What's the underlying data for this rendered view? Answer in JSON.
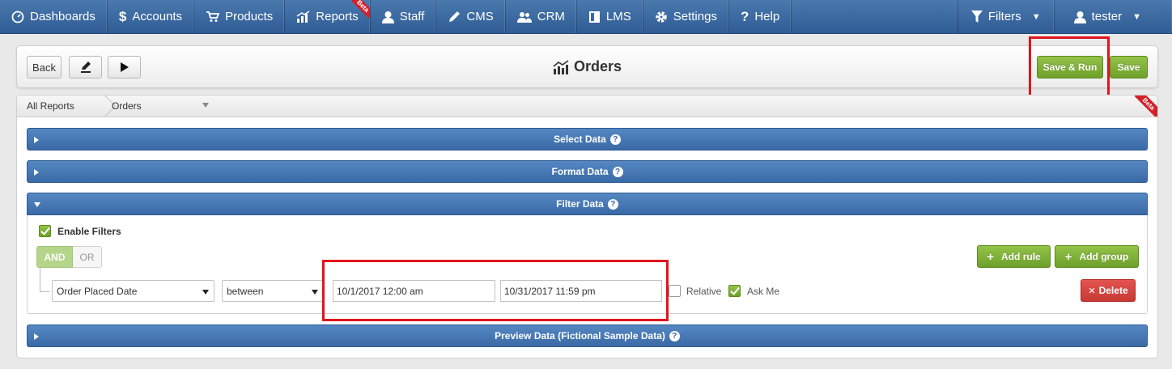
{
  "nav": {
    "items": [
      {
        "label": "Dashboards",
        "icon": "dashboard-icon"
      },
      {
        "label": "Accounts",
        "icon": "dollar-icon"
      },
      {
        "label": "Products",
        "icon": "cart-icon"
      },
      {
        "label": "Reports",
        "icon": "chart-icon",
        "badge": "Beta"
      },
      {
        "label": "Staff",
        "icon": "user-icon"
      },
      {
        "label": "CMS",
        "icon": "pencil-icon"
      },
      {
        "label": "CRM",
        "icon": "users-icon"
      },
      {
        "label": "LMS",
        "icon": "book-icon"
      },
      {
        "label": "Settings",
        "icon": "gear-icon"
      },
      {
        "label": "Help",
        "icon": "question-icon"
      }
    ],
    "filters_label": "Filters",
    "user_label": "tester"
  },
  "header": {
    "back_label": "Back",
    "title": "Orders",
    "save_run_label": "Save & Run",
    "save_label": "Save"
  },
  "breadcrumb": {
    "root": "All Reports",
    "current": "Orders",
    "badge": "Beta"
  },
  "sections": {
    "select_data": "Select Data",
    "format_data": "Format Data",
    "filter_data": "Filter Data",
    "preview_data": "Preview Data (Fictional Sample Data)"
  },
  "filter": {
    "enable_label": "Enable Filters",
    "enabled": true,
    "and_label": "AND",
    "or_label": "OR",
    "add_rule_label": "Add rule",
    "add_group_label": "Add group",
    "field_value": "Order Placed Date",
    "operator_value": "between",
    "from_value": "10/1/2017 12:00 am",
    "to_value": "10/31/2017 11:59 pm",
    "relative_label": "Relative",
    "relative_checked": false,
    "ask_me_label": "Ask Me",
    "ask_me_checked": true,
    "delete_label": "Delete"
  },
  "colors": {
    "nav_blue": "#3a6aa6",
    "accent_green": "#7fb13a",
    "danger_red": "#d43f3a",
    "highlight_red": "#e0141e"
  }
}
